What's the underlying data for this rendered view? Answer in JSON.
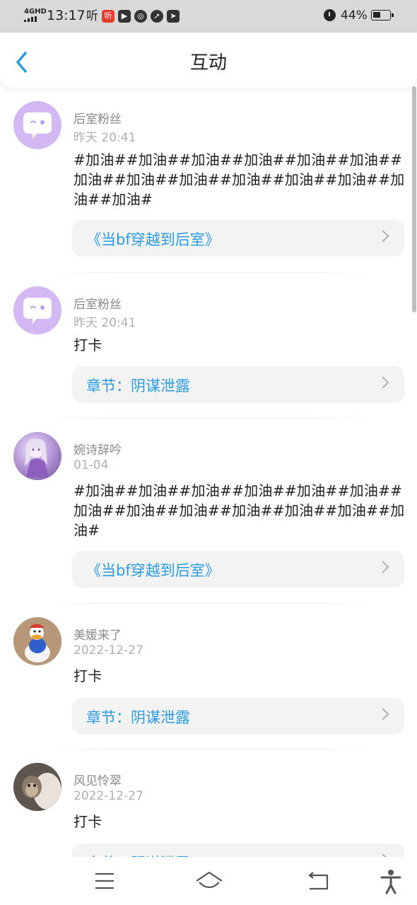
{
  "status_bar": {
    "network": "4GHD",
    "time": "13:17",
    "app_icons": [
      "听",
      "听-red",
      "play-icon",
      "chat-icon",
      "compass-icon",
      "send-icon"
    ],
    "battery": "44%"
  },
  "header": {
    "title": "互动"
  },
  "items": [
    {
      "avatar": "purple-chat-bubble-avatar",
      "username": "后室粉丝",
      "time": "昨天 20:41",
      "content": "#加油##加油##加油##加油##加油##加油##加油##加油##加油##加油##加油##加油##加油##加油#",
      "ref": "《当bf穿越到后室》"
    },
    {
      "avatar": "purple-chat-bubble-avatar",
      "username": "后室粉丝",
      "time": "昨天 20:41",
      "content": "打卡",
      "ref": "章节：阴谋泄露"
    },
    {
      "avatar": "anime-girl-avatar",
      "username": "婉诗辞吟",
      "time": "01-04",
      "content": "#加油##加油##加油##加油##加油##加油##加油##加油##加油##加油##加油##加油##加油#",
      "ref": "《当bf穿越到后室》"
    },
    {
      "avatar": "duck-avatar",
      "username": "美媛来了",
      "time": "2022-12-27",
      "content": "打卡",
      "ref": "章节：阴谋泄露"
    },
    {
      "avatar": "monkey-avatar",
      "username": "风见怜翠",
      "time": "2022-12-27",
      "content": "打卡",
      "ref": "章节：阴谋泄露"
    }
  ],
  "nav": [
    "menu-icon",
    "home-icon",
    "back-icon",
    "accessibility-icon"
  ],
  "colors": {
    "accent": "#2a9be0",
    "avatar_purple": "#d4b8f3",
    "card_bg": "#f3f3f3"
  }
}
